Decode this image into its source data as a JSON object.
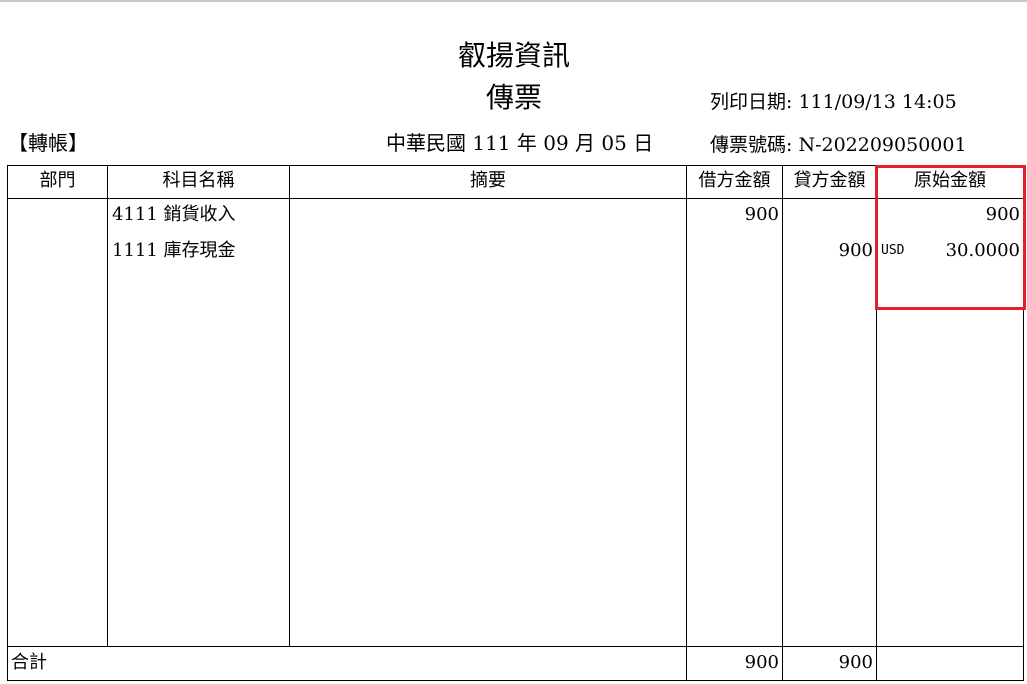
{
  "header": {
    "company": "叡揚資訊",
    "title": "傳票",
    "print_date": "列印日期: 111/09/13 14:05",
    "voucher_type": "【轉帳】",
    "voucher_date": "中華民國 111 年 09 月 05 日",
    "voucher_no": "傳票號碼: N-202209050001"
  },
  "table": {
    "columns": {
      "department": "部門",
      "account": "科目名稱",
      "summary": "摘要",
      "debit": "借方金額",
      "credit": "貸方金額",
      "original": "原始金額"
    },
    "rows": [
      {
        "account": "4111 銷貨收入",
        "debit": "900",
        "credit": "",
        "currency": "",
        "original": "900"
      },
      {
        "account": "1111 庫存現金",
        "debit": "",
        "credit": "900",
        "currency": "USD",
        "original": "30.0000"
      }
    ],
    "total": {
      "label": "合計",
      "debit": "900",
      "credit": "900"
    }
  },
  "highlight_color": "#e0202a"
}
